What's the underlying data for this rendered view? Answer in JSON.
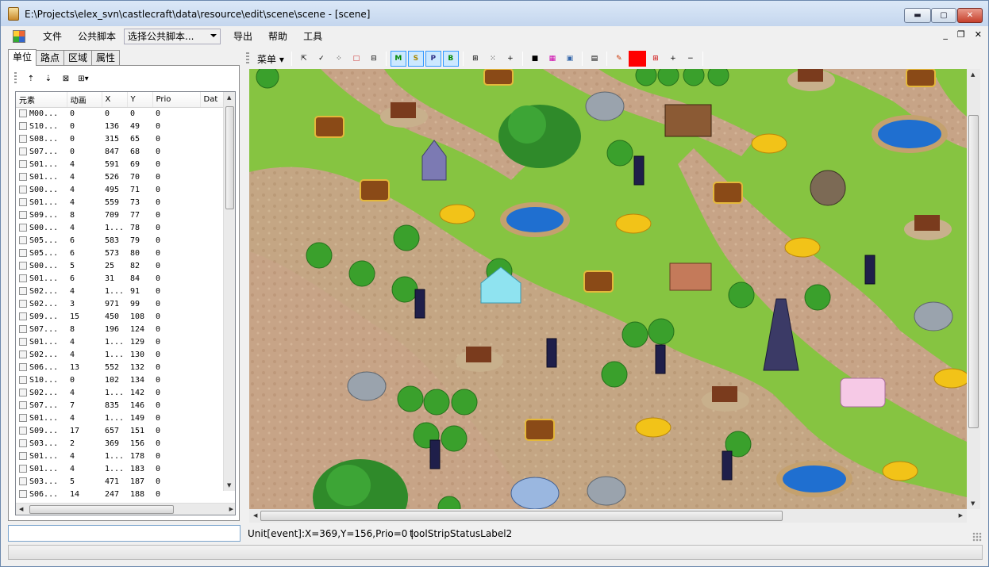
{
  "window": {
    "title": "E:\\Projects\\elex_svn\\castlecraft\\data\\resource\\edit\\scene\\scene - [scene]",
    "min_glyph": "▬",
    "max_glyph": "▢",
    "close_glyph": "✕"
  },
  "menubar": {
    "items": [
      "文件",
      "公共脚本"
    ],
    "combo_value": "选择公共脚本...",
    "items2": [
      "导出",
      "帮助",
      "工具"
    ],
    "mdi": [
      "_",
      "❐",
      "✕"
    ]
  },
  "left_tabs": [
    "单位",
    "路点",
    "区域",
    "属性"
  ],
  "unit_grid": {
    "columns": [
      "元素",
      "动画",
      "X",
      "Y",
      "Prio",
      "Dat"
    ],
    "rows": [
      [
        "M00...",
        "0",
        "0",
        "0",
        "0"
      ],
      [
        "S10...",
        "0",
        "136",
        "49",
        "0"
      ],
      [
        "S08...",
        "0",
        "315",
        "65",
        "0"
      ],
      [
        "S07...",
        "0",
        "847",
        "68",
        "0"
      ],
      [
        "S01...",
        "4",
        "591",
        "69",
        "0"
      ],
      [
        "S01...",
        "4",
        "526",
        "70",
        "0"
      ],
      [
        "S00...",
        "4",
        "495",
        "71",
        "0"
      ],
      [
        "S01...",
        "4",
        "559",
        "73",
        "0"
      ],
      [
        "S09...",
        "8",
        "709",
        "77",
        "0"
      ],
      [
        "S00...",
        "4",
        "1...",
        "78",
        "0"
      ],
      [
        "S05...",
        "6",
        "583",
        "79",
        "0"
      ],
      [
        "S05...",
        "6",
        "573",
        "80",
        "0"
      ],
      [
        "S00...",
        "5",
        "25",
        "82",
        "0"
      ],
      [
        "S01...",
        "6",
        "31",
        "84",
        "0"
      ],
      [
        "S02...",
        "4",
        "1...",
        "91",
        "0"
      ],
      [
        "S02...",
        "3",
        "971",
        "99",
        "0"
      ],
      [
        "S09...",
        "15",
        "450",
        "108",
        "0"
      ],
      [
        "S07...",
        "8",
        "196",
        "124",
        "0"
      ],
      [
        "S01...",
        "4",
        "1...",
        "129",
        "0"
      ],
      [
        "S02...",
        "4",
        "1...",
        "130",
        "0"
      ],
      [
        "S06...",
        "13",
        "552",
        "132",
        "0"
      ],
      [
        "S10...",
        "0",
        "102",
        "134",
        "0"
      ],
      [
        "S02...",
        "4",
        "1...",
        "142",
        "0"
      ],
      [
        "S07...",
        "7",
        "835",
        "146",
        "0"
      ],
      [
        "S01...",
        "4",
        "1...",
        "149",
        "0"
      ],
      [
        "S09...",
        "17",
        "657",
        "151",
        "0"
      ],
      [
        "S03...",
        "2",
        "369",
        "156",
        "0"
      ],
      [
        "S01...",
        "4",
        "1...",
        "178",
        "0"
      ],
      [
        "S01...",
        "4",
        "1...",
        "183",
        "0"
      ],
      [
        "S03...",
        "5",
        "471",
        "187",
        "0"
      ],
      [
        "S06...",
        "14",
        "247",
        "188",
        "0"
      ]
    ]
  },
  "map_toolbar": {
    "menu_label": "菜单"
  },
  "statusbar": {
    "coords": "Unit[event]:X=369,Y=156,Prio=0 |",
    "label2": "toolStripStatusLabel2"
  },
  "colors": {
    "grass": "#86c441",
    "path": "#c9a98a",
    "accent_red": "#ff0000"
  }
}
